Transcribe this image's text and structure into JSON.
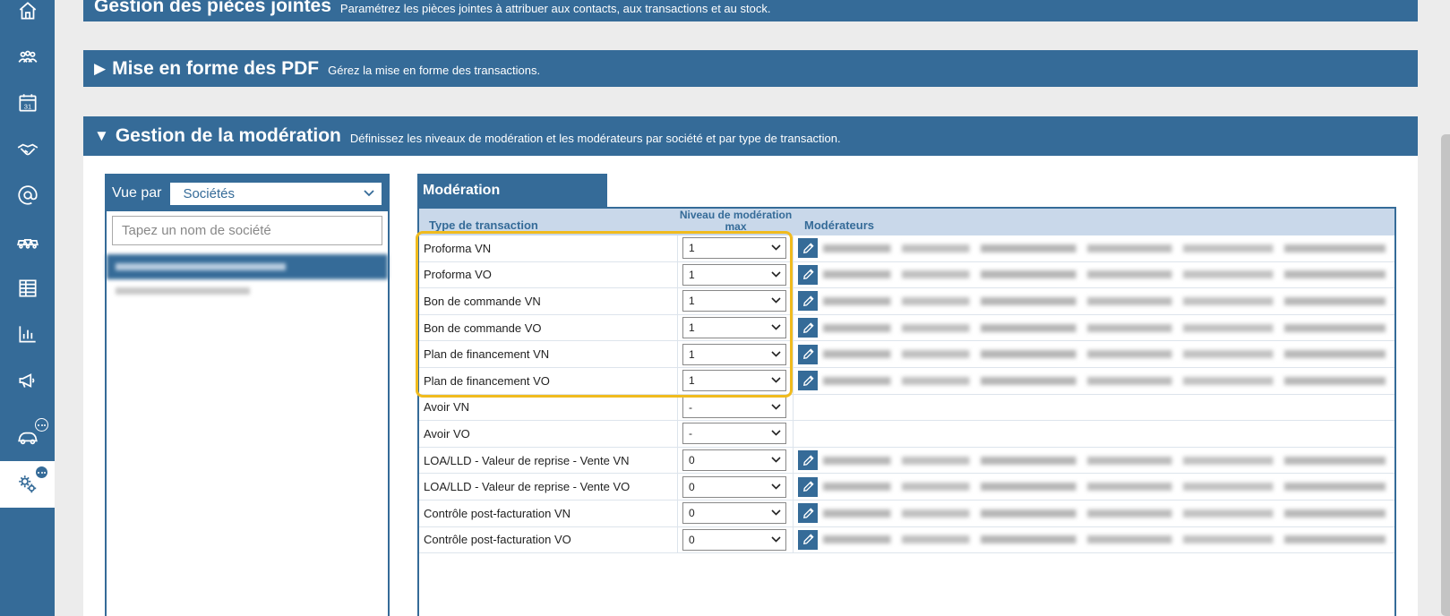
{
  "sidebar": {
    "icons": [
      "home-icon",
      "users-icon",
      "calendar-icon",
      "handshake-icon",
      "at-icon",
      "vehicles-icon",
      "table-icon",
      "chart-icon",
      "megaphone-icon",
      "car-icon",
      "settings-icon"
    ],
    "calendar_day": "31"
  },
  "sections": {
    "attachments": {
      "title": "Gestion des pièces jointes",
      "subtitle": "Paramétrez les pièces jointes à attribuer aux contacts, aux transactions et au stock."
    },
    "pdf": {
      "arrow": "▶",
      "title": "Mise en forme des PDF",
      "subtitle": "Gérez la mise en forme des transactions."
    },
    "moderation": {
      "arrow": "▼",
      "title": "Gestion de la modération",
      "subtitle": "Définissez les niveaux de modération et les modérateurs par société et par type de transaction."
    }
  },
  "vue_par": {
    "label": "Vue par",
    "selected": "Sociétés",
    "search_placeholder": "Tapez un nom de société"
  },
  "moderation": {
    "tab_label": "Modération",
    "columns": {
      "type": "Type de transaction",
      "level": "Niveau de modération max",
      "moderators": "Modérateurs"
    },
    "rows": [
      {
        "type": "Proforma VN",
        "level": "1",
        "has_moderators": true
      },
      {
        "type": "Proforma VO",
        "level": "1",
        "has_moderators": true
      },
      {
        "type": "Bon de commande VN",
        "level": "1",
        "has_moderators": true
      },
      {
        "type": "Bon de commande VO",
        "level": "1",
        "has_moderators": true
      },
      {
        "type": "Plan de financement VN",
        "level": "1",
        "has_moderators": true
      },
      {
        "type": "Plan de financement VO",
        "level": "1",
        "has_moderators": true
      },
      {
        "type": "Avoir VN",
        "level": "-",
        "has_moderators": false
      },
      {
        "type": "Avoir VO",
        "level": "-",
        "has_moderators": false
      },
      {
        "type": "LOA/LLD - Valeur de reprise - Vente VN",
        "level": "0",
        "has_moderators": true
      },
      {
        "type": "LOA/LLD - Valeur de reprise - Vente VO",
        "level": "0",
        "has_moderators": true
      },
      {
        "type": "Contrôle post-facturation VN",
        "level": "0",
        "has_moderators": true
      },
      {
        "type": "Contrôle post-facturation VO",
        "level": "0",
        "has_moderators": true
      }
    ]
  },
  "colors": {
    "brand": "#356b98",
    "header_bg": "#c9d8ea",
    "highlight": "#f0bb1e"
  }
}
